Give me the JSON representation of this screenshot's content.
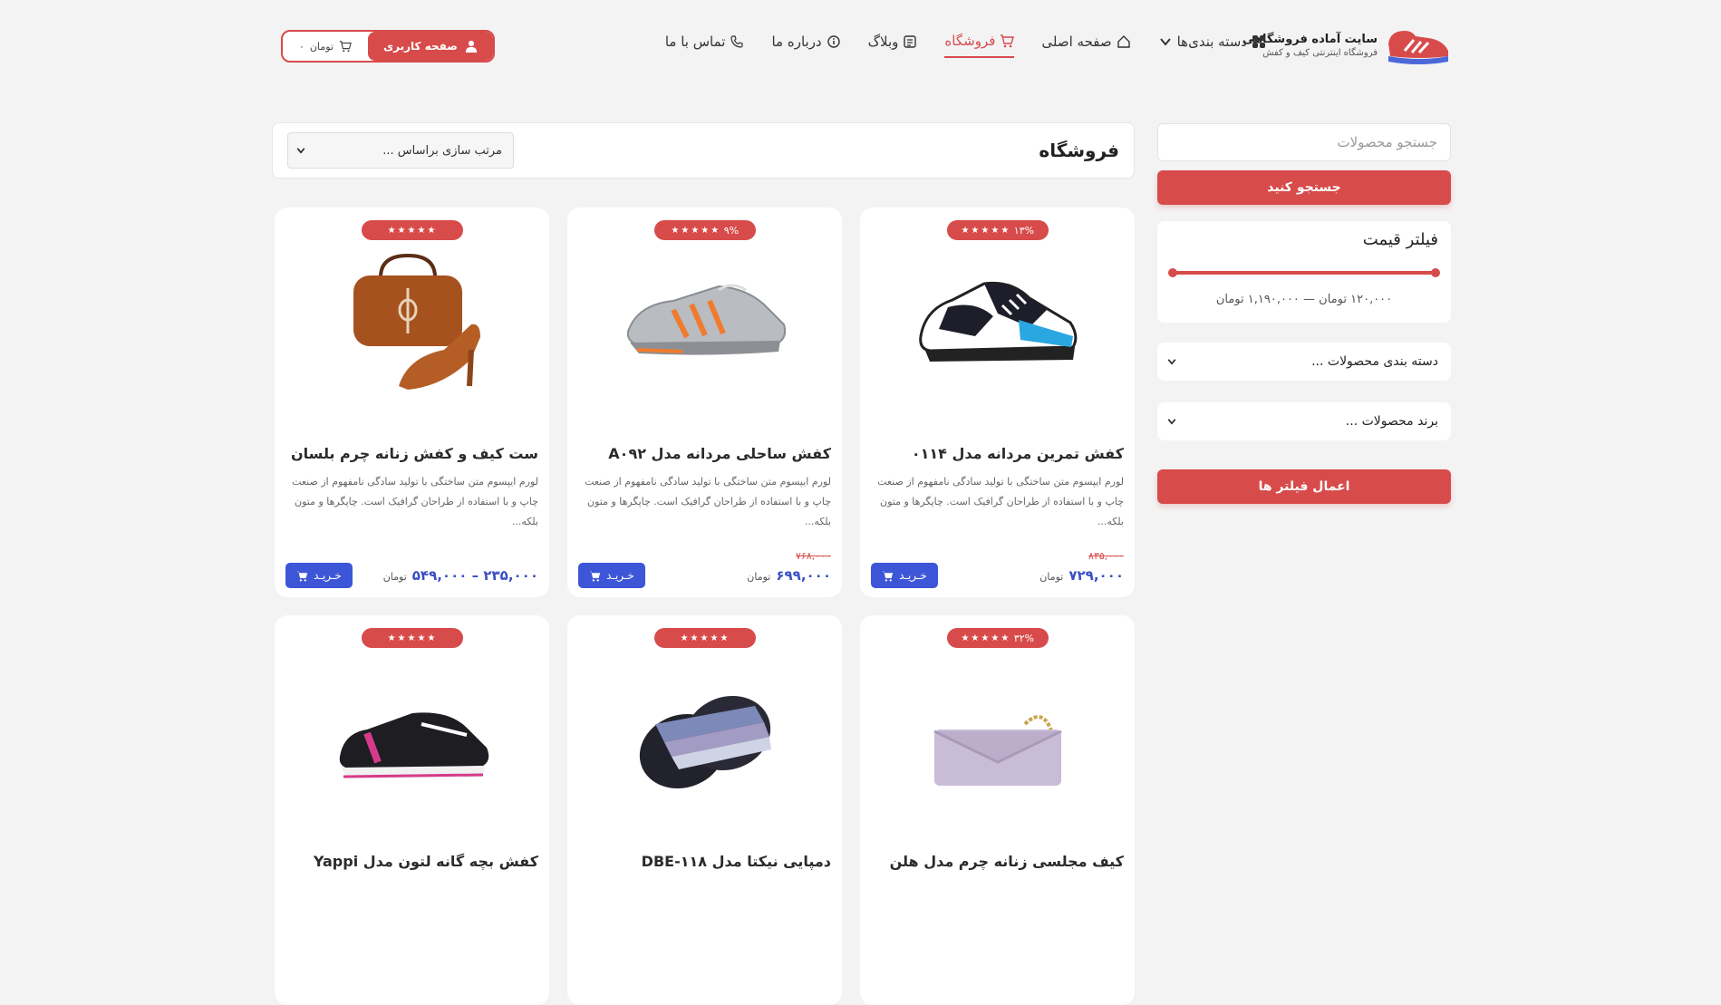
{
  "brand": {
    "title": "سایت آماده فروشگاهی",
    "subtitle": "فروشگاه اینترنتی کیف و کفش"
  },
  "nav": {
    "categories": "دسته بندی‌ها",
    "home": "صفحه اصلی",
    "shop": "فروشگاه",
    "blog": "وبلاگ",
    "about": "درباره ما",
    "contact": "تماس با ما"
  },
  "header": {
    "user_label": "صفحه کاربری",
    "cart_amount": "۰",
    "cart_currency": "تومان"
  },
  "sidebar": {
    "search_placeholder": "جستجو محصولات",
    "search_button": "جستجو کنید",
    "price_filter_title": "فیلتر قیمت",
    "price_range": "۱۲۰,۰۰۰ تومان — ۱,۱۹۰,۰۰۰ تومان",
    "category_select": "دسته بندی محصولات ...",
    "brand_select": "برند محصولات ...",
    "apply_button": "اعمال فیلتر ها"
  },
  "main": {
    "title": "فروشگاه",
    "sort_select": "مرتب سازی براساس ..."
  },
  "colors": {
    "accent": "#d84b4b",
    "price": "#3b4fc4",
    "buy": "#3d56d8"
  },
  "products": [
    {
      "title": "کفش تمرین مردانه مدل ۰۱۱۴",
      "discount": "۱۳%",
      "desc": "لورم ایپسوم متن ساختگی با تولید سادگی نامفهوم از صنعت چاپ و با استفاده از طراحان گرافیک است. چاپگرها و متون بلکه...",
      "old_price": "۸۳۵,۰۰۰",
      "price": "۷۲۹,۰۰۰",
      "currency": "تومان",
      "buy": "خـریـد",
      "image": "sneaker-black-white"
    },
    {
      "title": "کفش ساحلی مردانه مدل A۰۹۲",
      "discount": "۹%",
      "desc": "لورم ایپسوم متن ساختگی با تولید سادگی نامفهوم از صنعت چاپ و با استفاده از طراحان گرافیک است. چاپگرها و متون بلکه...",
      "old_price": "۷۶۸,۰۰۰",
      "price": "۶۹۹,۰۰۰",
      "currency": "تومان",
      "buy": "خـریـد",
      "image": "water-shoe-grey"
    },
    {
      "title": "ست کیف و کفش زنانه چرم بلسان",
      "discount": "",
      "desc": "لورم ایپسوم متن ساختگی با تولید سادگی نامفهوم از صنعت چاپ و با استفاده از طراحان گرافیک است. چاپگرها و متون بلکه...",
      "old_price": "",
      "price": "۲۳۵,۰۰۰ – ۵۴۹,۰۰۰",
      "currency": "تومان",
      "buy": "خـریـد",
      "image": "bag-and-heel-brown"
    },
    {
      "title": "کیف مجلسی زنانه چرم مدل هلن",
      "discount": "۳۲%",
      "desc": "",
      "old_price": "",
      "price": "",
      "currency": "",
      "buy": "",
      "image": "clutch-lilac"
    },
    {
      "title": "دمپایی نیکتا مدل DBE-۱۱۸",
      "discount": "",
      "desc": "",
      "old_price": "",
      "price": "",
      "currency": "",
      "buy": "",
      "image": "slide-slipper"
    },
    {
      "title": "کفش بچه گانه لتون مدل Yappi",
      "discount": "",
      "desc": "",
      "old_price": "",
      "price": "",
      "currency": "",
      "buy": "",
      "image": "kids-shoe-black"
    }
  ]
}
